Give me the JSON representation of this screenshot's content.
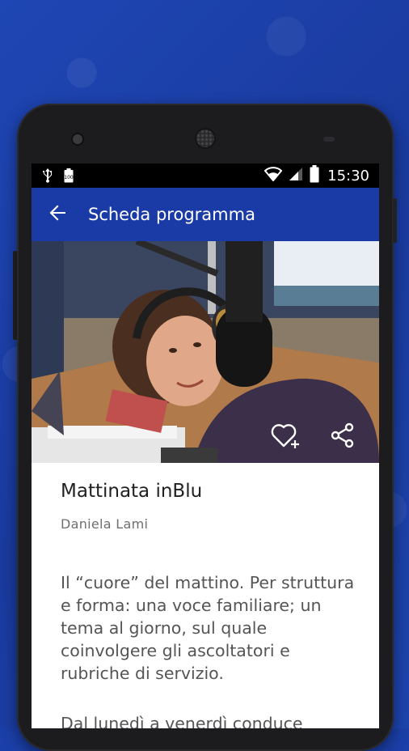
{
  "status_bar": {
    "time": "15:30",
    "icons": [
      "usb-icon",
      "battery-saver-icon",
      "wifi-icon",
      "signal-icon",
      "battery-icon"
    ]
  },
  "app_bar": {
    "back_icon": "arrow-back-icon",
    "title": "Scheda programma"
  },
  "hero": {
    "image_alt": "",
    "actions": [
      "heart-add-icon",
      "share-icon"
    ]
  },
  "program": {
    "title": "Mattinata inBlu",
    "host": "Daniela Lami",
    "description": "Il “cuore” del mattino. Per struttura e forma: una voce familiare; un tema al giorno, sul quale coinvolgere gli ascoltatori e rubriche di servizio.",
    "schedule_preview": "Dal lunedì a venerdì conduce"
  },
  "colors": {
    "brand_blue": "#1a3aa6",
    "background_blue": "#1b3fa8"
  }
}
